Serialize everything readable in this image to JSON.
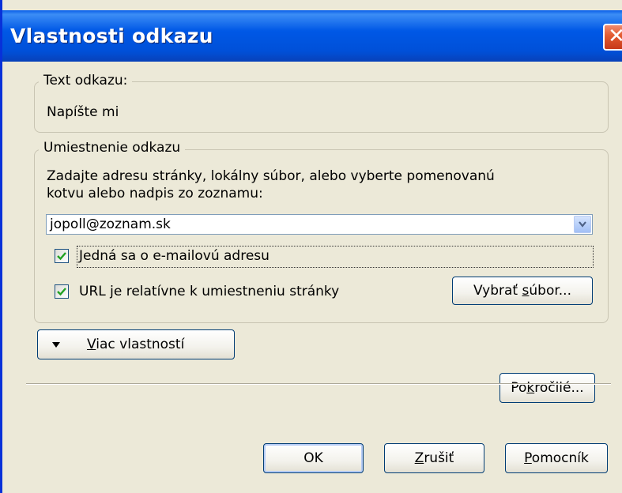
{
  "dialog": {
    "title": "Vlastnosti odkazu",
    "close_glyph": "✕"
  },
  "link_text_group": {
    "legend": "Text odkazu:",
    "value": "Napíšte mi"
  },
  "location_group": {
    "legend": "Umiestnenie odkazu",
    "instructions_line1": "Zadajte adresu stránky, lokálny súbor, alebo vyberte pomenovanú",
    "instructions_line2": "kotvu alebo nadpis zo zoznamu:",
    "url_combo": {
      "value": "jopoll@zoznam.sk"
    },
    "email_checkbox": {
      "label": "Jedná sa o e-mailovú adresu",
      "checked": true
    },
    "relative_checkbox": {
      "label": "URL je relatívne k umiestneniu stránky",
      "checked": true
    },
    "choose_file_button": {
      "label_pre": "Vybrať ",
      "label_accel": "s",
      "label_post": "úbor..."
    }
  },
  "more_properties_button": {
    "label_accel": "V",
    "label_post": "iac vlastností"
  },
  "advanced_button": {
    "label_pre": "Po",
    "label_accel": "k",
    "label_post": "ročilé..."
  },
  "footer": {
    "ok_label": "OK",
    "cancel_accel": "Z",
    "cancel_post": "rušiť",
    "help_accel": "P",
    "help_post": "omocník"
  },
  "colors": {
    "titlebar": "#0058E6",
    "dialog_bg": "#ECE9D8",
    "check_mark": "#21A121",
    "button_border": "#003C74"
  }
}
